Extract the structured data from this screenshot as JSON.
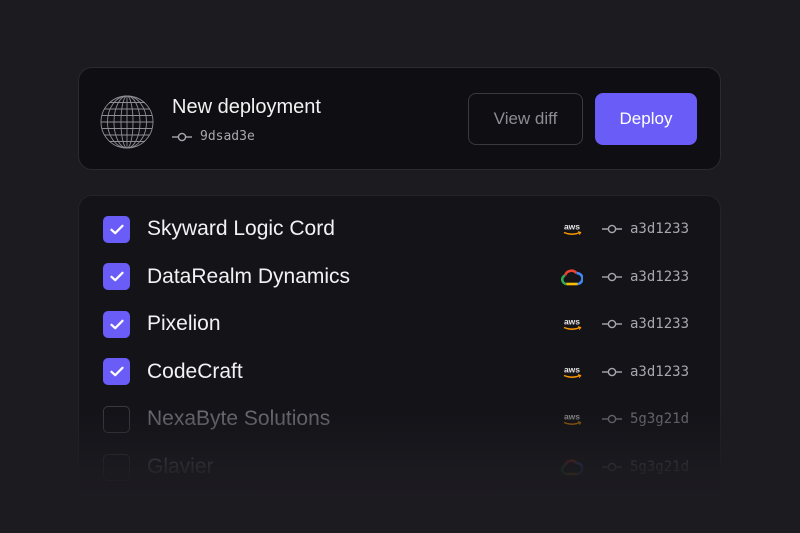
{
  "deployment": {
    "title": "New deployment",
    "commit": "9dsad3e",
    "view_diff_label": "View diff",
    "deploy_label": "Deploy"
  },
  "projects": [
    {
      "name": "Skyward Logic Cord",
      "checked": true,
      "provider": "aws-logo-icon",
      "commit": "a3d1233"
    },
    {
      "name": "DataRealm Dynamics",
      "checked": true,
      "provider": "google-cloud-logo-icon",
      "commit": "a3d1233"
    },
    {
      "name": "Pixelion",
      "checked": true,
      "provider": "aws-logo-icon",
      "commit": "a3d1233"
    },
    {
      "name": "CodeCraft",
      "checked": true,
      "provider": "aws-logo-icon",
      "commit": "a3d1233"
    },
    {
      "name": "NexaByte Solutions",
      "checked": false,
      "provider": "aws-logo-icon",
      "commit": "5g3g21d"
    },
    {
      "name": "Glavier",
      "checked": false,
      "provider": "google-cloud-logo-icon",
      "commit": "5g3g21d"
    }
  ],
  "colors": {
    "accent": "#6a5cf6",
    "background": "#1c1b20",
    "card": "#0f0e12"
  }
}
